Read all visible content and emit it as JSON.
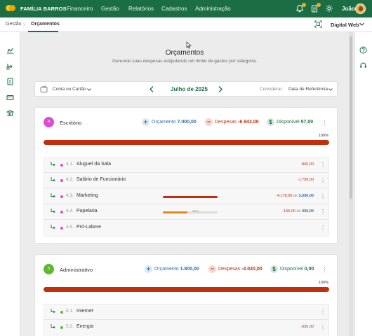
{
  "app": {
    "brand": "FAMÍLIA BARROS",
    "user": "João"
  },
  "nav": [
    "Financeiro",
    "Gestão",
    "Relatórios",
    "Cadastros",
    "Administração"
  ],
  "breadcrumb": {
    "parent": "Gestão",
    "current": "Orçamentos",
    "workspace": "Digital Web"
  },
  "page": {
    "title": "Orçamentos",
    "subtitle": "Gerencie suas despesas estipulando um limite de gastos por categoria."
  },
  "filters": {
    "account": "Conta ou Cartão",
    "month": "Julho de 2025",
    "consider_label": "Considerar",
    "reference": "Data de Referência"
  },
  "colors": {
    "brand": "#1b6e43",
    "expense": "#c12f0c",
    "budget": "#2b6ea8",
    "warning": "#e08a1a"
  },
  "groups": [
    {
      "code": "4",
      "name": "Escritório",
      "color": "#d94fd2",
      "budget_label": "Orçamento",
      "budget": "7.000,00",
      "expense_label": "Despesas",
      "expense": "-6.943,00",
      "available_label": "Disponível",
      "available": "57,00",
      "percent": "100%",
      "items": [
        {
          "code": "4.1.",
          "name": "Aluguel da Sala",
          "spent": "-860,00",
          "of": "",
          "limit": ""
        },
        {
          "code": "4.2.",
          "name": "Salário de Funcionário",
          "spent": "-1.750,00",
          "of": "",
          "limit": ""
        },
        {
          "code": "4.3.",
          "name": "Marketing",
          "spent": "-4.178,00",
          "of": "de",
          "limit": "3.000,00",
          "progress": 1.0,
          "bar_color": "#c12f0c"
        },
        {
          "code": "4.4.",
          "name": "Papelaria",
          "spent": "-155,00",
          "of": "de",
          "limit": "350,00",
          "progress": 0.45,
          "bar_label": "45%",
          "bar_color": "#e08a1a"
        },
        {
          "code": "4.5.",
          "name": "Pró-Labore",
          "spent": "",
          "of": "",
          "limit": ""
        }
      ]
    },
    {
      "code": "5",
      "name": "Administrativo",
      "color": "#5fb82e",
      "budget_label": "Orçamento",
      "budget": "1.800,00",
      "expense_label": "Despesas",
      "expense": "-4.020,00",
      "available_label": "Disponível",
      "available": "0,00",
      "percent": "100%",
      "items": [
        {
          "code": "5.1.",
          "name": "Internet",
          "spent": "",
          "of": "",
          "limit": ""
        },
        {
          "code": "5.2.",
          "name": "Energia",
          "spent": "-350,00",
          "of": "",
          "limit": ""
        }
      ]
    }
  ]
}
